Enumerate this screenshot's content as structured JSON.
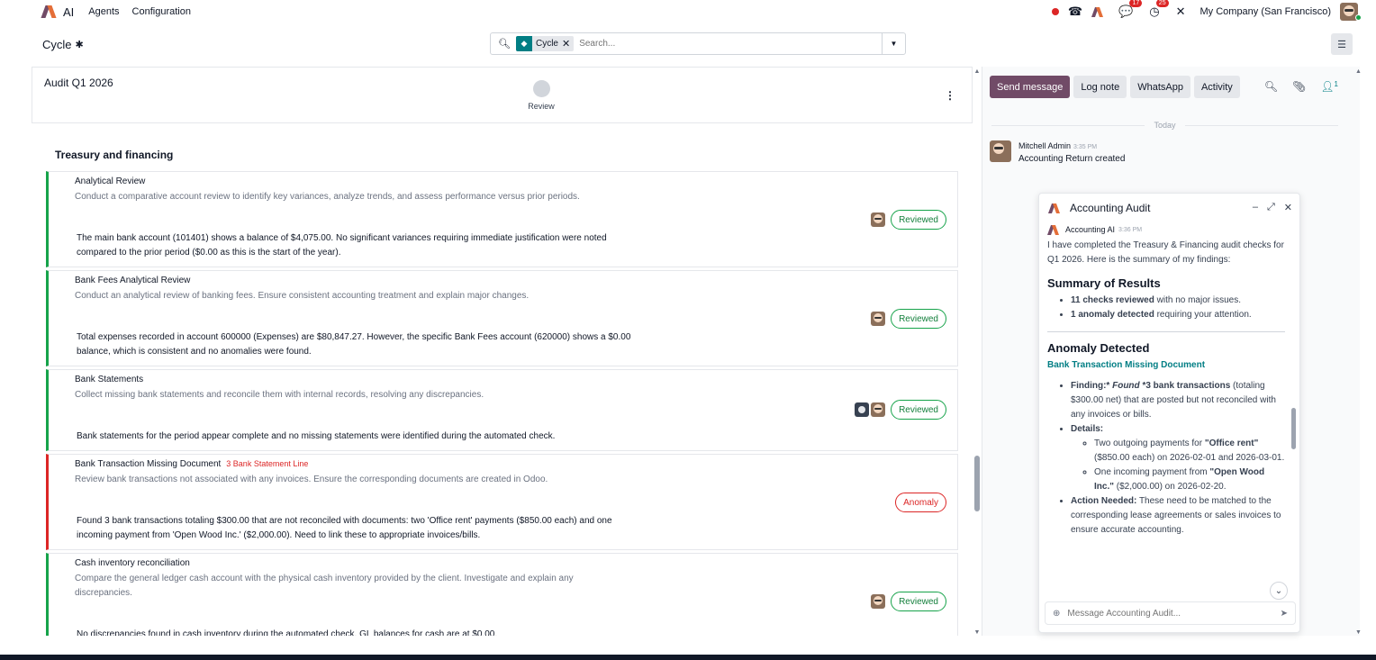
{
  "topbar": {
    "app_name": "AI",
    "menu": [
      "Agents",
      "Configuration"
    ],
    "chat_badge": "17",
    "activity_badge": "25",
    "company": "My Company (San Francisco)"
  },
  "control": {
    "breadcrumb": "Cycle",
    "facet_label": "Cycle",
    "search_placeholder": "Search..."
  },
  "record": {
    "name": "Audit Q1 2026",
    "stage": "Review"
  },
  "section_title": "Treasury and financing",
  "tasks": [
    {
      "name": "Analytical Review",
      "tag": "",
      "description": "Conduct a comparative account review to identify key variances, analyze trends, and assess performance versus prior periods.",
      "result": "The main bank account (101401) shows a balance of $4,075.00. No significant variances requiring immediate justification were noted compared to the prior period ($0.00 as this is the start of the year).",
      "status": "Reviewed"
    },
    {
      "name": "Bank Fees Analytical Review",
      "tag": "",
      "description": "Conduct an analytical review of banking fees. Ensure consistent accounting treatment and explain major changes.",
      "result": "Total expenses recorded in account 600000 (Expenses) are $80,847.27. However, the specific Bank Fees account (620000) shows a $0.00 balance, which is consistent and no anomalies were found.",
      "status": "Reviewed"
    },
    {
      "name": "Bank Statements",
      "tag": "",
      "description": "Collect missing bank statements and reconcile them with internal records, resolving any discrepancies.",
      "result": "Bank statements for the period appear complete and no missing statements were identified during the automated check.",
      "status": "Reviewed"
    },
    {
      "name": "Bank Transaction Missing Document",
      "tag": "3 Bank Statement Line",
      "description": "Review bank transactions not associated with any invoices. Ensure the corresponding documents are created in Odoo.",
      "result": "Found 3 bank transactions totaling $300.00 that are not reconciled with documents: two 'Office rent' payments ($850.00 each) and one incoming payment from 'Open Wood Inc.' ($2,000.00). Need to link these to appropriate invoices/bills.",
      "status": "Anomaly"
    },
    {
      "name": "Cash inventory reconciliation",
      "tag": "",
      "description": "Compare the general ledger cash account with the physical cash inventory provided by the client. Investigate and explain any discrepancies.",
      "result": "No discrepancies found in cash inventory during the automated check. GL balances for cash are at $0.00.",
      "status": "Reviewed"
    }
  ],
  "chatter": {
    "send_message": "Send message",
    "log_note": "Log note",
    "whatsapp": "WhatsApp",
    "activity": "Activity",
    "follower_count": "1",
    "today": "Today",
    "message": {
      "author": "Mitchell Admin",
      "time": "3:35 PM",
      "body": "Accounting Return created"
    }
  },
  "chat_window": {
    "title": "Accounting Audit",
    "ai_author": "Accounting AI",
    "ai_time": "3:36 PM",
    "intro": "I have completed the Treasury & Financing audit checks for Q1 2026. Here is the summary of my findings:",
    "summary_title": "Summary of Results",
    "summary_1_bold": "11 checks reviewed",
    "summary_1_rest": " with no major issues.",
    "summary_2_bold": "1 anomaly detected",
    "summary_2_rest": " requiring your attention.",
    "anomaly_title": "Anomaly Detected",
    "anomaly_subtitle": "Bank Transaction Missing Document",
    "finding_label": "Finding:*",
    "finding_italic": " Found ",
    "finding_bold": "*3 bank transactions",
    "finding_rest": " (totaling $300.00 net) that are posted but not reconciled with any invoices or bills.",
    "details_label": "Details:",
    "detail_1_a": "Two outgoing payments for ",
    "detail_1_bold": "\"Office rent\"",
    "detail_1_b": " ($850.00 each) on 2026-02-01 and 2026-03-01.",
    "detail_2_a": "One incoming payment from ",
    "detail_2_bold": "\"Open Wood Inc.\"",
    "detail_2_b": " ($2,000.00) on 2026-02-20.",
    "action_label": "Action Needed:",
    "action_rest": " These need to be matched to the corresponding lease agreements or sales invoices to ensure accurate accounting.",
    "input_placeholder": "Message Accounting Audit..."
  },
  "colors": {
    "brand": "#714B67",
    "reviewed": "#16a34a",
    "anomaly": "#dc2626",
    "teal": "#017e84"
  }
}
